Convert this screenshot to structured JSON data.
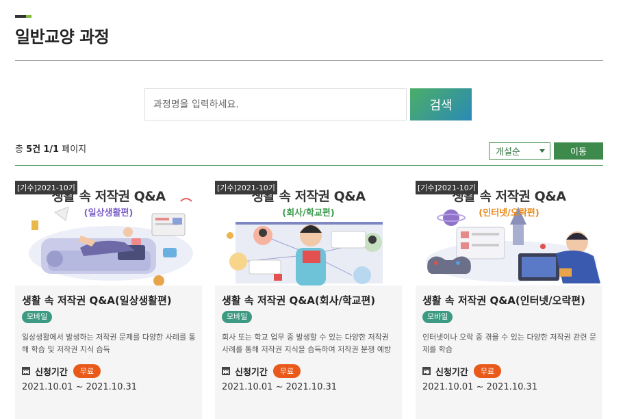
{
  "header": {
    "title": "일반교양 과정"
  },
  "search": {
    "placeholder": "과정명을 입력하세요.",
    "button_label": "검색"
  },
  "results": {
    "total_prefix": "총",
    "total_count": "5건",
    "pages": "1/1",
    "pages_suffix": "페이지"
  },
  "sort": {
    "selected": "개설순",
    "move_label": "이동"
  },
  "cards": [
    {
      "term": "[기수]2021-10기",
      "thumb_title": "생활 속 저작권 Q&A",
      "thumb_subtitle": "(일상생활편)",
      "thumb_color": "#7b5fc8",
      "title": "생활 속 저작권 Q&A(일상생활편)",
      "badge": "모바일",
      "description": "일상생활에서 발생하는 저작권 문제를 다양한 사례를 통해 학습 및 저작권 지식 습득",
      "period_label": "신청기간",
      "price": "무료",
      "dates": "2021.10.01 ~ 2021.10.31"
    },
    {
      "term": "[기수]2021-10기",
      "thumb_title": "생활 속 저작권 Q&A",
      "thumb_subtitle": "(회사/학교편)",
      "thumb_color": "#3a9a4a",
      "title": "생활 속 저작권 Q&A(회사/학교편)",
      "badge": "모바일",
      "description": "회사 또는 학교 업무 중 발생할 수 있는 다양한 저작권 사례를 통해 저작권 지식을 습득하여 저작권 분쟁 예방",
      "period_label": "신청기간",
      "price": "무료",
      "dates": "2021.10.01 ~ 2021.10.31"
    },
    {
      "term": "[기수]2021-10기",
      "thumb_title": "생활 속 저작권 Q&A",
      "thumb_subtitle": "(인터넷/오락편)",
      "thumb_color": "#e8891a",
      "title": "생활 속 저작권 Q&A(인터넷/오락편)",
      "badge": "모바일",
      "description": "인터넷이나 오락 중 겪을 수 있는 다양한 저작권 관련 문제를 학습",
      "period_label": "신청기간",
      "price": "무료",
      "dates": "2021.10.01 ~ 2021.10.31"
    }
  ]
}
